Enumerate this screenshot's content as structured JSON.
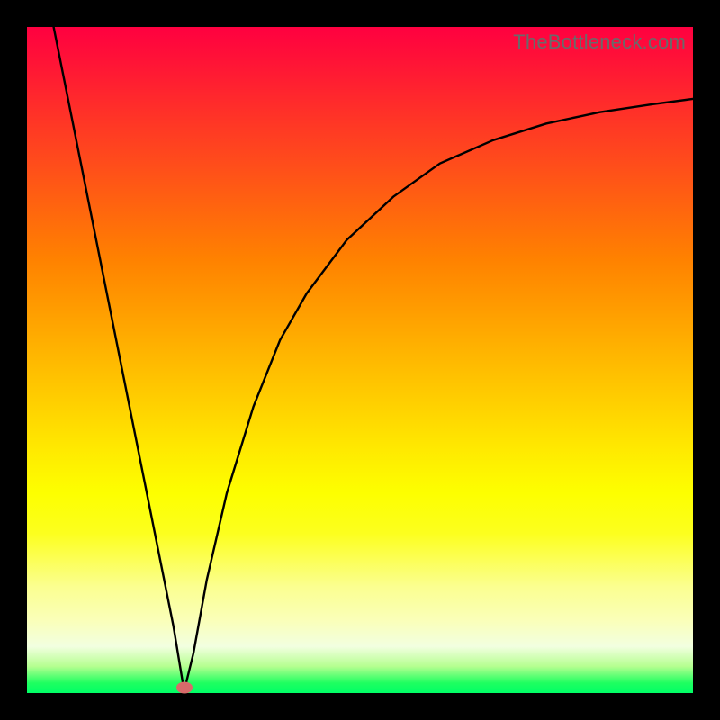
{
  "watermark": "TheBottleneck.com",
  "chart_data": {
    "type": "line",
    "title": "",
    "xlabel": "",
    "ylabel": "",
    "x_range": [
      0,
      100
    ],
    "y_range": [
      0,
      100
    ],
    "grid": false,
    "legend": false,
    "series": [
      {
        "name": "bottleneck-curve",
        "x": [
          4,
          6,
          8,
          10,
          12,
          14,
          16,
          18,
          20,
          22,
          23.6,
          25,
          27,
          30,
          34,
          38,
          42,
          48,
          55,
          62,
          70,
          78,
          86,
          94,
          100
        ],
        "y": [
          100,
          90,
          80,
          70,
          60,
          50,
          40,
          30,
          20,
          10,
          0.3,
          6,
          17,
          30,
          43,
          53,
          60,
          68,
          74.5,
          79.5,
          83,
          85.5,
          87.2,
          88.4,
          89.2
        ]
      }
    ],
    "markers": [
      {
        "name": "min-point",
        "x": 23.6,
        "y": 0.8,
        "color": "#d86a6a"
      }
    ],
    "colors": {
      "curve": "#000000",
      "frame": "#000000",
      "gradient_top": "#ff0040",
      "gradient_bottom": "#00ff66",
      "marker": "#d86a6a"
    }
  }
}
